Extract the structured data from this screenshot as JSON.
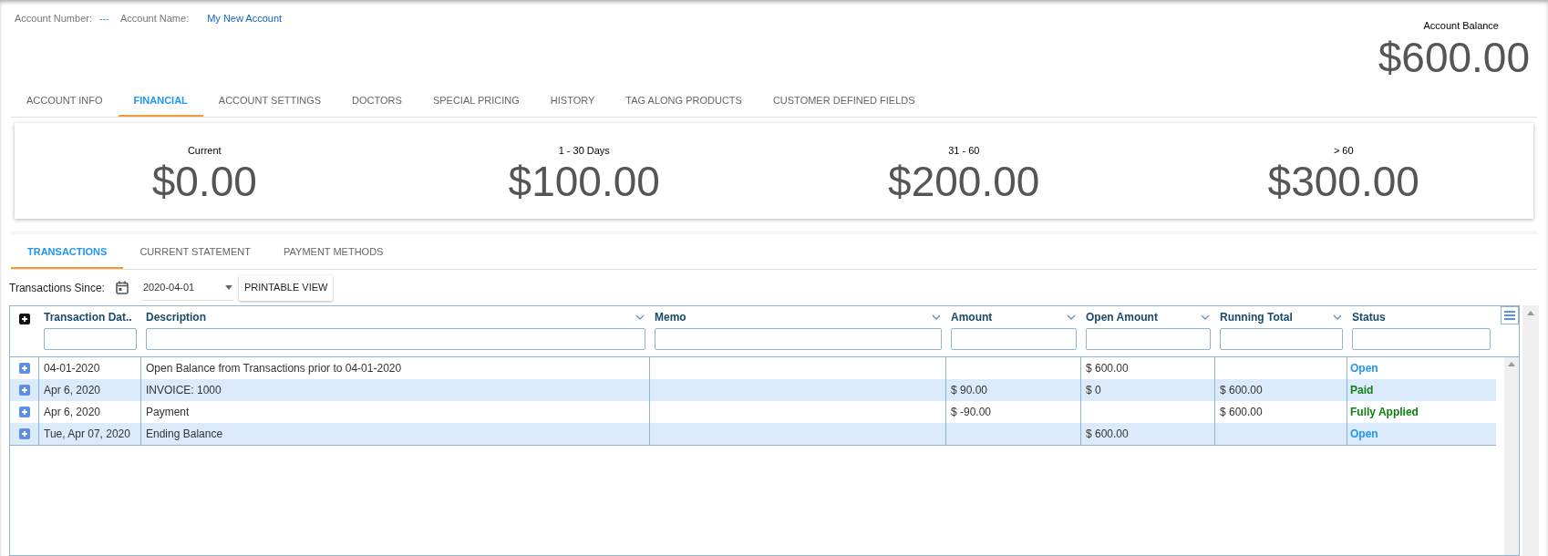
{
  "account": {
    "number_label": "Account Number:",
    "number": "---",
    "name_label": "Account Name:",
    "name": "My New Account"
  },
  "balance": {
    "label": "Account Balance",
    "value": "$600.00"
  },
  "tabs": [
    {
      "label": "ACCOUNT INFO",
      "selected": false
    },
    {
      "label": "FINANCIAL",
      "selected": true
    },
    {
      "label": "ACCOUNT SETTINGS",
      "selected": false
    },
    {
      "label": "DOCTORS",
      "selected": false
    },
    {
      "label": "SPECIAL PRICING",
      "selected": false
    },
    {
      "label": "HISTORY",
      "selected": false
    },
    {
      "label": "TAG ALONG PRODUCTS",
      "selected": false
    },
    {
      "label": "CUSTOMER DEFINED FIELDS",
      "selected": false
    }
  ],
  "aging": [
    {
      "label": "Current",
      "value": "$0.00"
    },
    {
      "label": "1 - 30 Days",
      "value": "$100.00"
    },
    {
      "label": "31 - 60",
      "value": "$200.00"
    },
    {
      "label": "> 60",
      "value": "$300.00"
    }
  ],
  "sub_tabs": [
    {
      "label": "TRANSACTIONS",
      "selected": true
    },
    {
      "label": "CURRENT STATEMENT",
      "selected": false
    },
    {
      "label": "PAYMENT METHODS",
      "selected": false
    }
  ],
  "toolbar": {
    "since_label": "Transactions Since:",
    "date": "2020-04-01",
    "button": "PRINTABLE VIEW"
  },
  "table": {
    "columns": [
      "Transaction Dat..",
      "Description",
      "Memo",
      "Amount",
      "Open Amount",
      "Running Total",
      "Status"
    ],
    "rows": [
      {
        "cells": [
          "04-01-2020",
          "Open Balance from Transactions prior to 04-01-2020",
          "",
          "",
          "$ 600.00",
          ""
        ],
        "status": "Open",
        "color": "#2196f3"
      },
      {
        "cells": [
          "Apr 6, 2020",
          "INVOICE: 1000",
          "",
          "$ 90.00",
          "$ 0",
          "$ 600.00"
        ],
        "status": "Paid",
        "color": "#108010"
      },
      {
        "cells": [
          "Apr 6, 2020",
          "Payment",
          "",
          "$ -90.00",
          "",
          "$ 600.00"
        ],
        "status": "Fully Applied",
        "color": "#108010"
      },
      {
        "cells": [
          "Tue, Apr 07, 2020",
          "Ending Balance",
          "",
          "",
          "$ 600.00",
          ""
        ],
        "status": "Open",
        "color": "#2196f3"
      }
    ]
  }
}
